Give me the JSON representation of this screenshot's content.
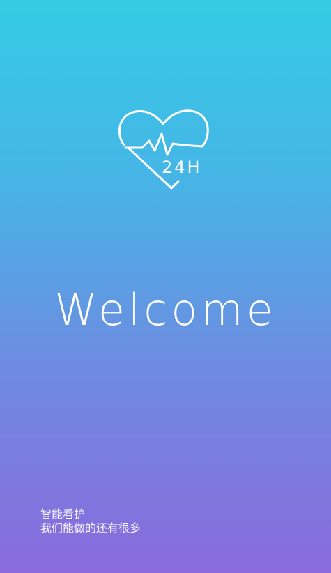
{
  "splash": {
    "logo": {
      "icon": "heart-pulse-24h-icon",
      "badge_text": "24H"
    },
    "title": "Welcome",
    "tagline": {
      "line1": "智能看护",
      "line2": "我们能做的还有很多"
    }
  },
  "colors": {
    "gradient_top": "#35cbe5",
    "gradient_bottom": "#8a6add",
    "foreground": "#ffffff"
  }
}
